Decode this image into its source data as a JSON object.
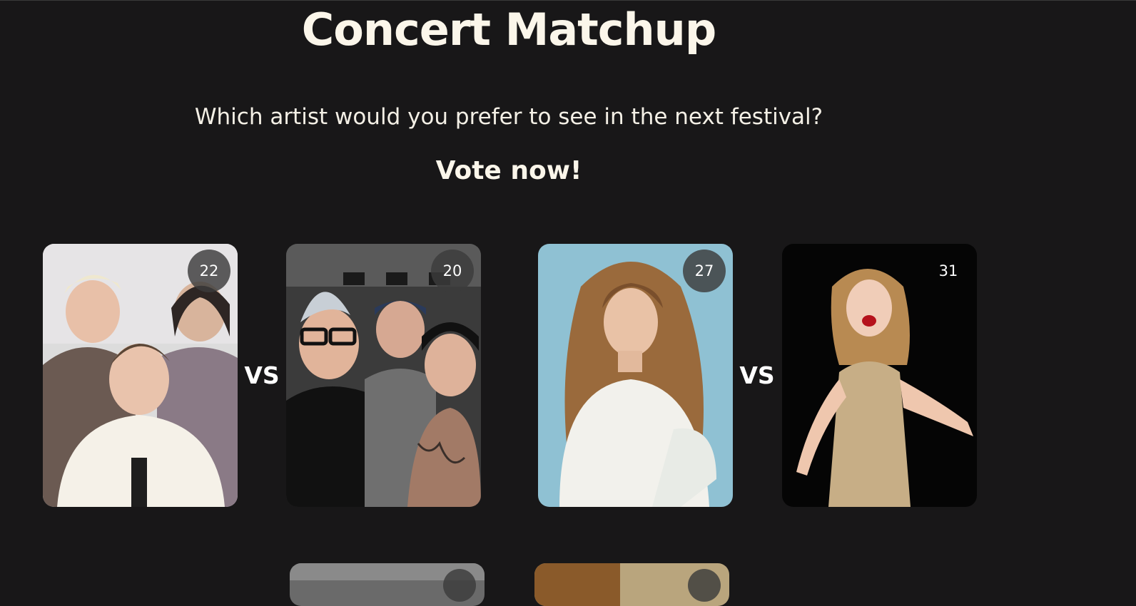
{
  "page": {
    "title": "Concert Matchup",
    "subtitle": "Which artist would you prefer to see in the next festival?",
    "cta": "Vote now!"
  },
  "matchups": [
    {
      "left": {
        "votes": "22"
      },
      "vs_label": "VS",
      "right": {
        "votes": "20"
      }
    },
    {
      "left": {
        "votes": "27"
      },
      "vs_label": "VS",
      "right": {
        "votes": "31"
      }
    }
  ],
  "colors": {
    "background": "#181718",
    "heading": "#fbf6ea",
    "badge": "#3c3c3c"
  }
}
